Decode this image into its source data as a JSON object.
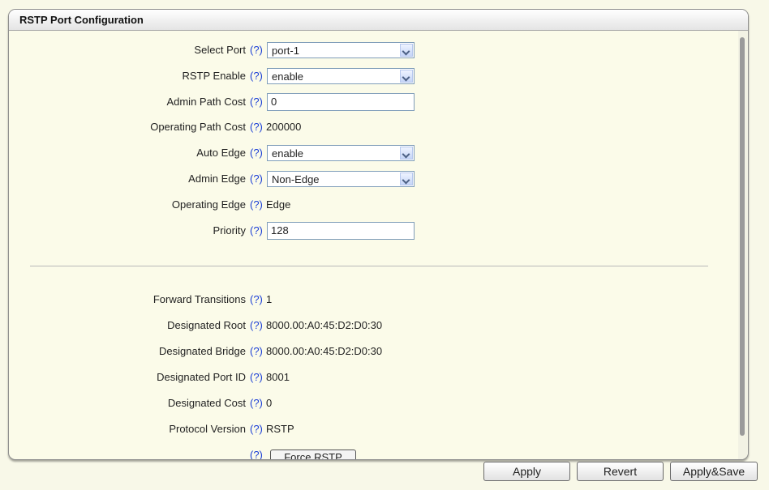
{
  "panel": {
    "title": "RSTP Port Configuration"
  },
  "help_text": "(?)",
  "fields": {
    "select_port": {
      "label": "Select Port",
      "value": "port-1"
    },
    "rstp_enable": {
      "label": "RSTP Enable",
      "value": "enable"
    },
    "admin_path_cost": {
      "label": "Admin Path Cost",
      "value": "0"
    },
    "operating_path_cost": {
      "label": "Operating Path Cost",
      "value": "200000"
    },
    "auto_edge": {
      "label": "Auto Edge",
      "value": "enable"
    },
    "admin_edge": {
      "label": "Admin Edge",
      "value": "Non-Edge"
    },
    "operating_edge": {
      "label": "Operating Edge",
      "value": "Edge"
    },
    "priority": {
      "label": "Priority",
      "value": "128"
    }
  },
  "status": {
    "forward_transitions": {
      "label": "Forward Transitions",
      "value": "1"
    },
    "designated_root": {
      "label": "Designated Root",
      "value": "8000.00:A0:45:D2:D0:30"
    },
    "designated_bridge": {
      "label": "Designated Bridge",
      "value": "8000.00:A0:45:D2:D0:30"
    },
    "designated_port_id": {
      "label": "Designated Port ID",
      "value": "8001"
    },
    "designated_cost": {
      "label": "Designated Cost",
      "value": "0"
    },
    "protocol_version": {
      "label": "Protocol Version",
      "value": "RSTP"
    }
  },
  "force_rstp_button": "Force RSTP",
  "footer": {
    "apply": "Apply",
    "revert": "Revert",
    "apply_save": "Apply&Save"
  }
}
